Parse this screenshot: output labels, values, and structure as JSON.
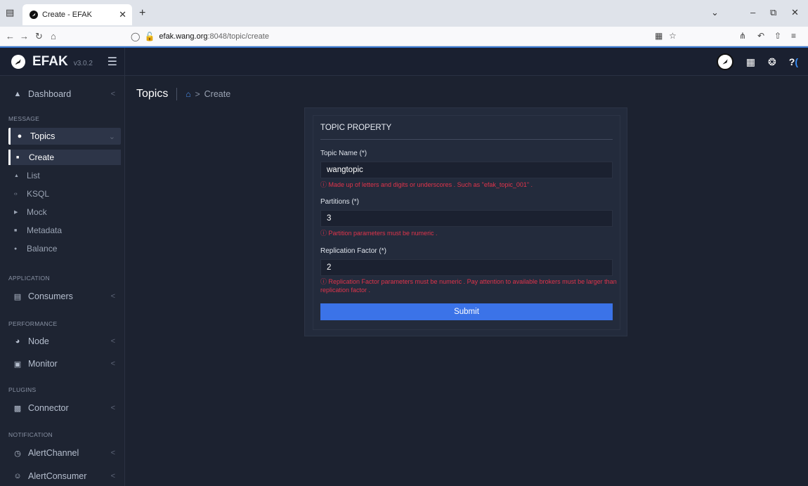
{
  "browser": {
    "tab_title": "Create - EFAK",
    "url_host": "efak.wang.org",
    "url_rest": ":8048/topic/create"
  },
  "app": {
    "brand": "EFAK",
    "version": "v3.0.2"
  },
  "sidebar": {
    "dashboard": "Dashboard",
    "sections": {
      "message": "MESSAGE",
      "application": "APPLICATION",
      "performance": "PERFORMANCE",
      "plugins": "PLUGINS",
      "notification": "NOTIFICATION"
    },
    "topics": "Topics",
    "topic_subs": [
      "Create",
      "List",
      "KSQL",
      "Mock",
      "Metadata",
      "Balance"
    ],
    "consumers": "Consumers",
    "node": "Node",
    "monitor": "Monitor",
    "connector": "Connector",
    "alert_channel": "AlertChannel",
    "alert_consumer": "AlertConsumer"
  },
  "breadcrumb": {
    "title": "Topics",
    "current": "Create"
  },
  "form": {
    "title": "TOPIC PROPERTY",
    "topic_name_label": "Topic Name (*)",
    "topic_name_value": "wangtopic",
    "topic_name_help": "ⓘ Made up of letters and digits or underscores . Such as \"efak_topic_001\" .",
    "partitions_label": "Partitions (*)",
    "partitions_value": "3",
    "partitions_help": "ⓘ Partition parameters must be numeric .",
    "replication_label": "Replication Factor (*)",
    "replication_value": "2",
    "replication_help": "ⓘ Replication Factor parameters must be numeric . Pay attention to available brokers must be larger than replication factor .",
    "submit_label": "Submit"
  },
  "colors": {
    "accent": "#3b73e8",
    "error": "#e0344b",
    "background": "#1c2230"
  }
}
